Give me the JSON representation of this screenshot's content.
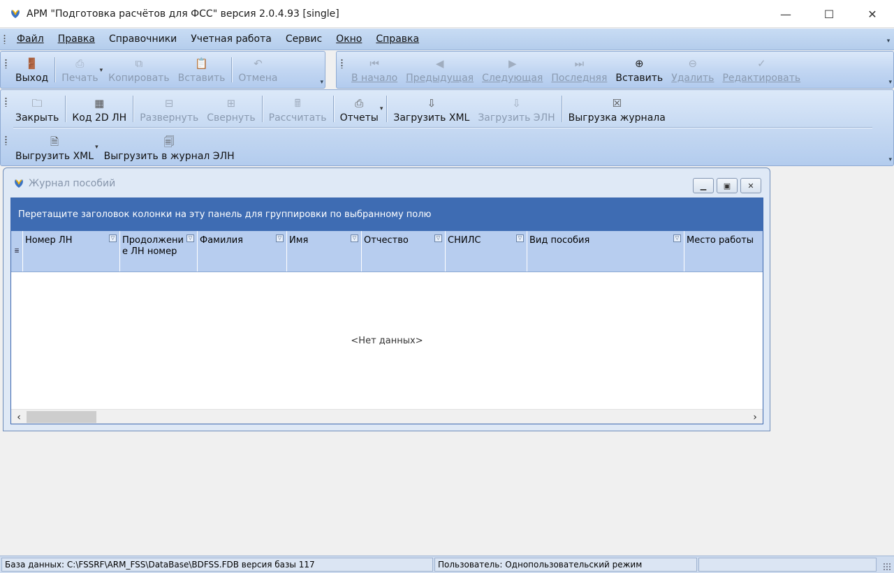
{
  "window": {
    "title": "АРМ \"Подготовка расчётов для ФСС\"   версия 2.0.4.93 [single]",
    "minimize": "—",
    "maximize": "☐",
    "close": "✕"
  },
  "menu": {
    "items": [
      {
        "label": "Файл",
        "underlined": true
      },
      {
        "label": "Правка",
        "underlined": true
      },
      {
        "label": "Справочники",
        "underlined": false
      },
      {
        "label": "Учетная работа",
        "underlined": false
      },
      {
        "label": "Сервис",
        "underlined": false
      },
      {
        "label": "Окно",
        "underlined": true
      },
      {
        "label": "Справка",
        "underlined": true
      }
    ]
  },
  "toolbar_main": {
    "exit": "Выход",
    "print": "Печать",
    "copy": "Копировать",
    "paste": "Вставить",
    "undo": "Отмена"
  },
  "toolbar_nav": {
    "first": "В начало",
    "prev": "Предыдущая",
    "next": "Следующая",
    "last": "Последняя",
    "insert": "Вставить",
    "delete": "Удалить",
    "edit": "Редактировать"
  },
  "toolbar_journal": {
    "close": "Закрыть",
    "code2d": "Код 2D  ЛН",
    "expand": "Развернуть",
    "collapse": "Свернуть",
    "calculate": "Рассчитать",
    "reports": "Отчеты",
    "load_xml": "Загрузить XML",
    "load_eln": "Загрузить ЭЛН",
    "export_journal": "Выгрузка журнала",
    "export_xml": "Выгрузить XML",
    "export_eln_journal": "Выгрузить в журнал ЭЛН"
  },
  "child_window": {
    "title": "Журнал пособий",
    "group_hint": "Перетащите заголовок колонки на эту панель для группировки по выбранному полю",
    "columns": [
      "Номер ЛН",
      "Продолжени е ЛН номер",
      "Фамилия",
      "Имя",
      "Отчество",
      "СНИЛС",
      "Вид пособия",
      "Место работы"
    ],
    "no_data": "<Нет данных>"
  },
  "status": {
    "database": "База данных: C:\\FSSRF\\ARM_FSS\\DataBase\\BDFSS.FDB  версия базы 117",
    "user": "Пользователь: Однопользовательский режим",
    "extra": ""
  }
}
